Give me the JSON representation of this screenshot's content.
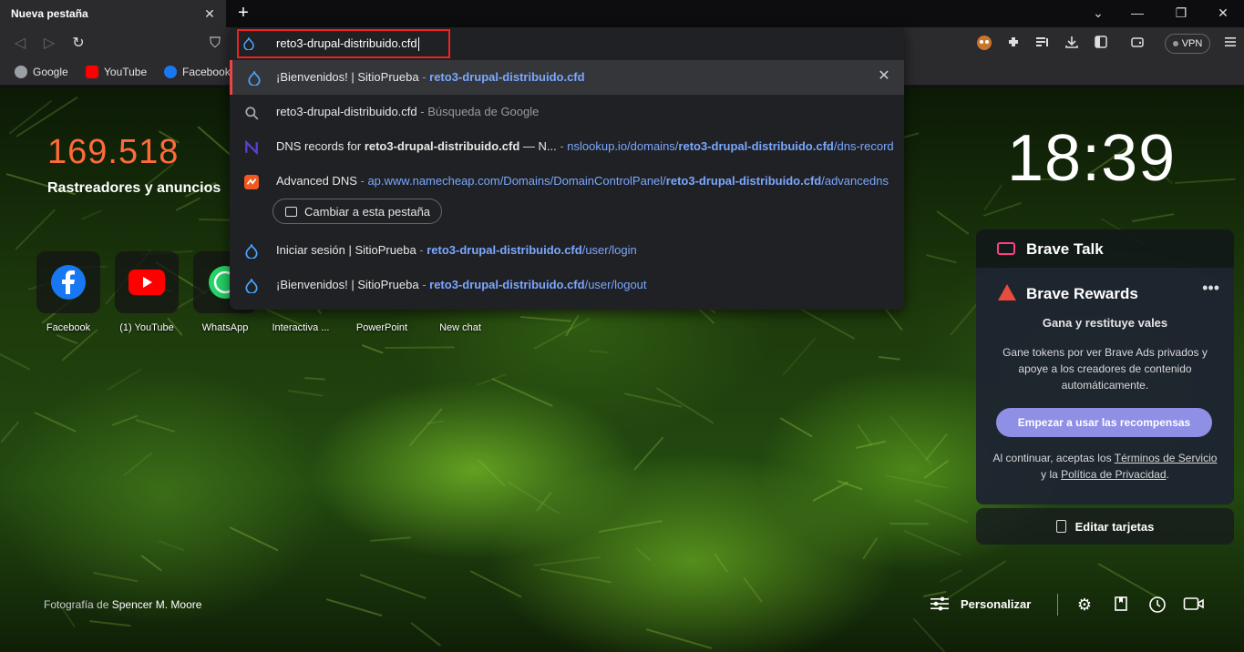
{
  "tab": {
    "title": "Nueva pestaña",
    "close": "✕",
    "new_tab": "+"
  },
  "window_controls": {
    "dropdown": "⌄",
    "minimize": "—",
    "restore": "❐",
    "close": "✕"
  },
  "toolbar": {
    "back": "◁",
    "forward": "▷",
    "reload": "↻",
    "bookmark": "⛉",
    "vpn_label": "VPN"
  },
  "bookmarks": [
    {
      "label": "Google",
      "icon": "globe-icon",
      "color": "#9aa0a6"
    },
    {
      "label": "YouTube",
      "icon": "youtube-icon",
      "color": "#ff0000"
    },
    {
      "label": "Facebook",
      "icon": "facebook-icon",
      "color": "#1877f2"
    }
  ],
  "omnibox": {
    "value": "reto3-drupal-distribuido.cfd",
    "suggestions": [
      {
        "title": "¡Bienvenidos! | SitioPrueba",
        "sep": " - ",
        "url_bold": "reto3-drupal-distribuido.cfd",
        "url_rest": "",
        "icon": "drupal-icon",
        "remove": "✕"
      },
      {
        "title": "reto3-drupal-distribuido.cfd",
        "sep": " - ",
        "suffix": "Búsqueda de Google",
        "icon": "search-icon"
      },
      {
        "title_pre": "DNS records for ",
        "title_bold": "reto3-drupal-distribuido.cfd",
        "title_post": " — N...",
        "sep": "  - ",
        "url_pre": "nslookup.io/domains/",
        "url_bold": "reto3-drupal-distribuido.cfd",
        "url_rest": "/dns-records",
        "icon": "nslookup-icon"
      },
      {
        "title": "Advanced DNS",
        "sep": "  - ",
        "url_pre": "ap.www.namecheap.com/Domains/DomainControlPanel/",
        "url_bold": "reto3-drupal-distribuido.cfd",
        "url_rest": "/advancedns",
        "icon": "namecheap-icon"
      },
      {
        "title": "Iniciar sesión | SitioPrueba",
        "sep": " - ",
        "url_bold": "reto3-drupal-distribuido.cfd",
        "url_rest": "/user/login",
        "icon": "drupal-icon"
      },
      {
        "title": "¡Bienvenidos! | SitioPrueba",
        "sep": " - ",
        "url_bold": "reto3-drupal-distribuido.cfd",
        "url_rest": "/user/logout",
        "icon": "drupal-icon"
      }
    ],
    "switch_tab_label": "Cambiar a esta pestaña"
  },
  "stats": {
    "count": "169.518",
    "label": "Rastreadores y anuncios"
  },
  "clock": "18:39",
  "top_sites": [
    {
      "label": "Facebook"
    },
    {
      "label": "(1) YouTube"
    },
    {
      "label": "WhatsApp"
    },
    {
      "label": "Interactiva ..."
    },
    {
      "label": "PowerPoint"
    },
    {
      "label": "New chat"
    }
  ],
  "brave_talk": {
    "title": "Brave Talk"
  },
  "brave_rewards": {
    "title": "Brave Rewards",
    "more": "•••",
    "headline": "Gana y restituye vales",
    "body": "Gane tokens por ver Brave Ads privados y apoye a los creadores de contenido automáticamente.",
    "button": "Empezar a usar las recompensas",
    "legal_pre": "Al continuar, aceptas los ",
    "legal_terms": "Términos de Servicio",
    "legal_mid": " y la ",
    "legal_privacy": "Política de Privacidad",
    "legal_post": "."
  },
  "edit_cards": "Editar tarjetas",
  "photo_credit": {
    "prefix": "Fotografía de ",
    "author": "Spencer M. Moore"
  },
  "customize": "Personalizar",
  "colors": {
    "accent_red": "#ff6a3a",
    "link_blue": "#8ab4ff",
    "rewards_button": "#8f8fe6"
  }
}
